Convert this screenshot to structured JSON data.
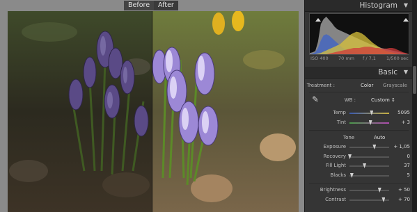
{
  "view": {
    "before_label": "Before",
    "after_label": "After"
  },
  "histogram": {
    "title": "Histogram",
    "iso": "ISO 400",
    "focal": "70 mm",
    "aperture": "f / 7,1",
    "shutter": "1/500 sec",
    "levels": {
      "gray": [
        2,
        3,
        5,
        20,
        48,
        56,
        60,
        55,
        50,
        44,
        40,
        38,
        36,
        34,
        32,
        30,
        28,
        26,
        24,
        22,
        20,
        18,
        16,
        15,
        13,
        12,
        10,
        9,
        8,
        7,
        6,
        5,
        4,
        3,
        2,
        1,
        0
      ],
      "blue": [
        0,
        1,
        3,
        10,
        22,
        30,
        32,
        30,
        26,
        22,
        18,
        14,
        10,
        8,
        6,
        5,
        4,
        3,
        2,
        1,
        1,
        1,
        0,
        0,
        0,
        0,
        0,
        0,
        0,
        0,
        0,
        0,
        0,
        0,
        0,
        0,
        0
      ],
      "yellow": [
        0,
        0,
        0,
        1,
        2,
        4,
        6,
        8,
        10,
        12,
        14,
        16,
        20,
        24,
        28,
        32,
        34,
        36,
        35,
        33,
        30,
        26,
        22,
        18,
        15,
        12,
        9,
        7,
        5,
        4,
        3,
        2,
        1,
        0,
        0,
        0,
        0
      ],
      "red": [
        0,
        0,
        0,
        0,
        0,
        0,
        0,
        1,
        2,
        3,
        4,
        5,
        6,
        7,
        8,
        9,
        10,
        10,
        10,
        11,
        12,
        12,
        12,
        11,
        10,
        10,
        9,
        9,
        9,
        10,
        10,
        9,
        7,
        5,
        3,
        2,
        0
      ]
    },
    "colors": {
      "gray": "#9a9a9a",
      "blue": "#3d63c8",
      "yellow": "#d8c23a",
      "red": "#d03a3a"
    }
  },
  "basic": {
    "title": "Basic",
    "treatment_label": "Treatment :",
    "treatment_color": "Color",
    "treatment_gray": "Grayscale",
    "wb_label": "WB :",
    "wb_value": "Custom ↕",
    "temp": {
      "label": "Temp",
      "value": "5095",
      "level": 0.55
    },
    "tint": {
      "label": "Tint",
      "value": "+ 3",
      "level": 0.52
    },
    "tone_label": "Tone",
    "auto_label": "Auto",
    "exposure": {
      "label": "Exposure",
      "value": "+ 1,05",
      "level": 0.62
    },
    "recovery": {
      "label": "Recovery",
      "value": "0",
      "level": 0.0
    },
    "fill_light": {
      "label": "Fill Light",
      "value": "37",
      "level": 0.37
    },
    "blacks": {
      "label": "Blacks",
      "value": "5",
      "level": 0.05
    },
    "brightness": {
      "label": "Brightness",
      "value": "+ 50",
      "level": 0.75
    },
    "contrast": {
      "label": "Contrast",
      "value": "+ 70",
      "level": 0.85
    }
  }
}
